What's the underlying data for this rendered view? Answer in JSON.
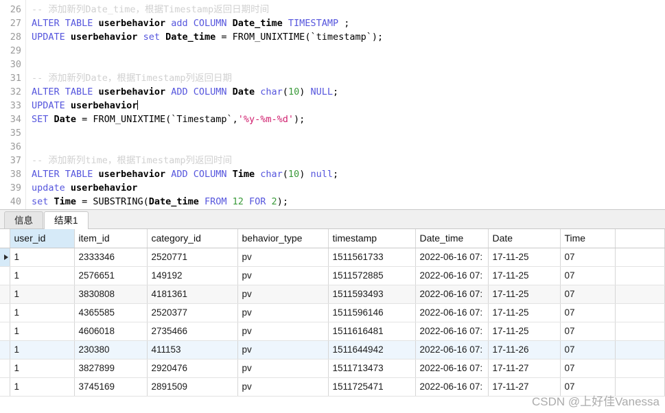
{
  "editor": {
    "first_line_number": 26,
    "lines": [
      {
        "n": 26,
        "text": "-- 添加新列Date_time，根据Timestamp返回日期时间"
      },
      {
        "n": 27,
        "text": "ALTER TABLE userbehavior add COLUMN Date_time TIMESTAMP ;"
      },
      {
        "n": 28,
        "text": "UPDATE userbehavior set Date_time = FROM_UNIXTIME(`timestamp`);"
      },
      {
        "n": 29,
        "text": ""
      },
      {
        "n": 30,
        "text": ""
      },
      {
        "n": 31,
        "text": "-- 添加新列Date，根据Timestamp列返回日期"
      },
      {
        "n": 32,
        "text": "ALTER TABLE userbehavior ADD COLUMN Date char(10) NULL;"
      },
      {
        "n": 33,
        "text": "UPDATE userbehavior"
      },
      {
        "n": 34,
        "text": "SET Date = FROM_UNIXTIME(`Timestamp`,'%y-%m-%d');"
      },
      {
        "n": 35,
        "text": ""
      },
      {
        "n": 36,
        "text": ""
      },
      {
        "n": 37,
        "text": "-- 添加新列time，根据Timestamp列返回时间"
      },
      {
        "n": 38,
        "text": "ALTER TABLE userbehavior ADD COLUMN Time char(10) null;"
      },
      {
        "n": 39,
        "text": "update userbehavior"
      },
      {
        "n": 40,
        "text": "set Time = SUBSTRING(Date_time FROM 12 FOR 2);"
      }
    ]
  },
  "tabs": [
    {
      "label": "信息",
      "active": false
    },
    {
      "label": "结果1",
      "active": true
    }
  ],
  "grid": {
    "columns": [
      "user_id",
      "item_id",
      "category_id",
      "behavior_type",
      "timestamp",
      "Date_time",
      "Date",
      "Time"
    ],
    "selected_column": "user_id",
    "rows": [
      {
        "cells": [
          "1",
          "2333346",
          "2520771",
          "pv",
          "1511561733",
          "2022-06-16 07:",
          "17-11-25",
          "07"
        ],
        "current": true,
        "shade": "none"
      },
      {
        "cells": [
          "1",
          "2576651",
          "149192",
          "pv",
          "1511572885",
          "2022-06-16 07:",
          "17-11-25",
          "07"
        ],
        "current": false,
        "shade": "none"
      },
      {
        "cells": [
          "1",
          "3830808",
          "4181361",
          "pv",
          "1511593493",
          "2022-06-16 07:",
          "17-11-25",
          "07"
        ],
        "current": false,
        "shade": "alt"
      },
      {
        "cells": [
          "1",
          "4365585",
          "2520377",
          "pv",
          "1511596146",
          "2022-06-16 07:",
          "17-11-25",
          "07"
        ],
        "current": false,
        "shade": "none"
      },
      {
        "cells": [
          "1",
          "4606018",
          "2735466",
          "pv",
          "1511616481",
          "2022-06-16 07:",
          "17-11-25",
          "07"
        ],
        "current": false,
        "shade": "none"
      },
      {
        "cells": [
          "1",
          "230380",
          "411153",
          "pv",
          "1511644942",
          "2022-06-16 07:",
          "17-11-26",
          "07"
        ],
        "current": false,
        "shade": "hl"
      },
      {
        "cells": [
          "1",
          "3827899",
          "2920476",
          "pv",
          "1511713473",
          "2022-06-16 07:",
          "17-11-27",
          "07"
        ],
        "current": false,
        "shade": "none"
      },
      {
        "cells": [
          "1",
          "3745169",
          "2891509",
          "pv",
          "1511725471",
          "2022-06-16 07:",
          "17-11-27",
          "07"
        ],
        "current": false,
        "shade": "none"
      }
    ]
  },
  "watermark": "CSDN @上好佳Vanessa",
  "colors": {
    "keyword": "#5555dd",
    "string": "#d01f6e",
    "number": "#3a9a3a",
    "comment": "#d0d0d0",
    "selection": "#d6eaf8",
    "row_highlight": "#eef6fd"
  }
}
